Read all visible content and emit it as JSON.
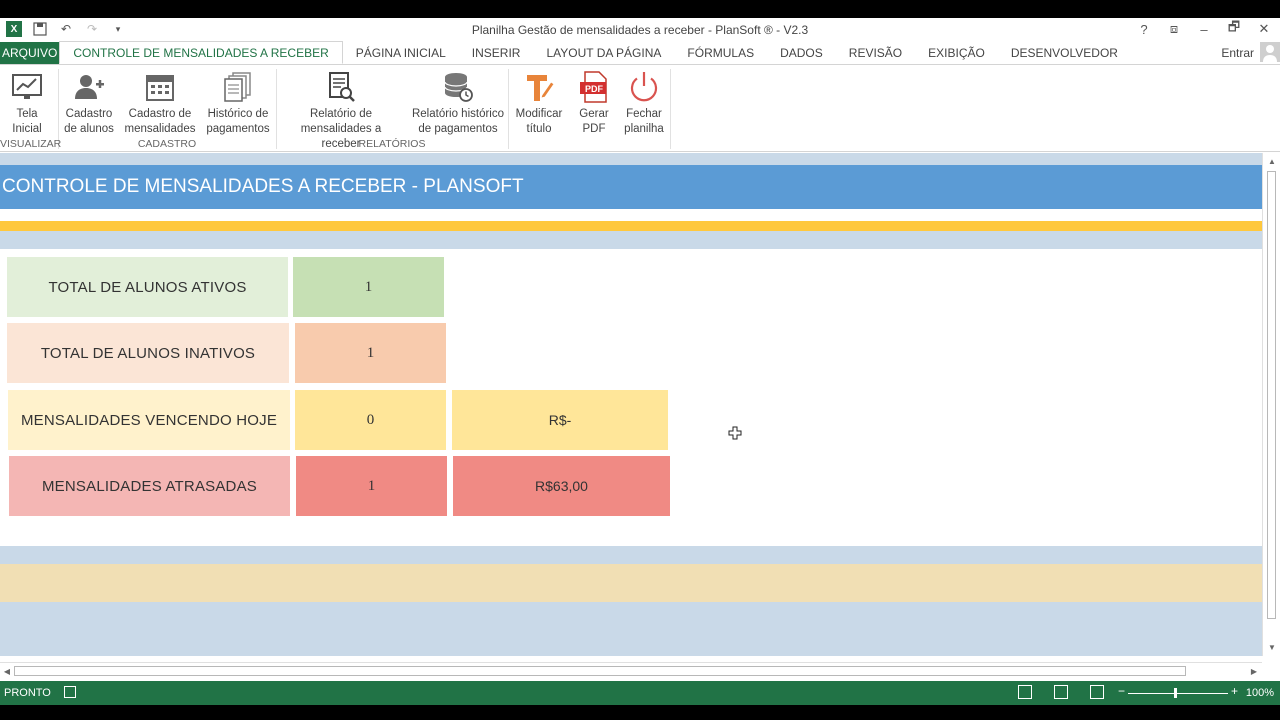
{
  "window": {
    "title": "Planilha Gestão de mensalidades a receber - PlanSoft ® - V2.3",
    "logo": "X",
    "help": "?",
    "controls": [
      "⧈",
      "–",
      "🗗",
      "✕"
    ]
  },
  "tabs": [
    {
      "label": "ARQUIVO",
      "kind": "file"
    },
    {
      "label": "CONTROLE DE MENSALIDADES A RECEBER",
      "kind": "active"
    },
    {
      "label": "PÁGINA INICIAL",
      "kind": ""
    },
    {
      "label": "INSERIR",
      "kind": ""
    },
    {
      "label": "LAYOUT DA PÁGINA",
      "kind": ""
    },
    {
      "label": "FÓRMULAS",
      "kind": ""
    },
    {
      "label": "DADOS",
      "kind": ""
    },
    {
      "label": "REVISÃO",
      "kind": ""
    },
    {
      "label": "EXIBIÇÃO",
      "kind": ""
    },
    {
      "label": "DESENVOLVEDOR",
      "kind": ""
    }
  ],
  "account": {
    "signin": "Entrar"
  },
  "ribbon": {
    "tela_inicial": "Tela\nInicial",
    "cadastro_alunos": "Cadastro\nde alunos",
    "cadastro_mensalidades": "Cadastro de\nmensalidades",
    "historico_pagamentos": "Histórico de\npagamentos",
    "relatorio_mensalidades": "Relatório de\nmensalidades a receber",
    "relatorio_historico": "Relatório histórico\nde pagamentos",
    "modificar_titulo": "Modificar\ntítulo",
    "gerar_pdf": "Gerar\nPDF",
    "fechar_planilha": "Fechar\nplanilha",
    "pdf_badge": "PDF",
    "groups": {
      "visualizar": "VISUALIZAR",
      "cadastro": "CADASTRO",
      "relatorios": "RELATÓRIOS"
    }
  },
  "sheet": {
    "header": "CONTROLE DE MENSALIDADES A RECEBER - PLANSOFT",
    "rows": [
      {
        "label": "TOTAL DE ALUNOS ATIVOS",
        "count": "1",
        "amount": null
      },
      {
        "label": "TOTAL DE ALUNOS INATIVOS",
        "count": "1",
        "amount": null
      },
      {
        "label": "MENSALIDADES VENCENDO HOJE",
        "count": "0",
        "amount": "R$-"
      },
      {
        "label": "MENSALIDADES ATRASADAS",
        "count": "1",
        "amount": "R$63,00"
      }
    ]
  },
  "status": {
    "ready": "PRONTO",
    "zoom": "100%"
  },
  "colors": {
    "excel_green": "#217346",
    "header_blue": "#5b9bd5",
    "gold_stripe": "#ffc83d",
    "light_blue_band": "#c9d9e8",
    "tan_band": "#f1dfb4",
    "active_light": "#e2efd9",
    "active_value": "#c6e0b4",
    "inactive_light": "#fbe5d6",
    "inactive_value": "#f8cbad",
    "today_light": "#fff2cc",
    "today_value": "#ffe699",
    "late_light": "#f4b6b4",
    "late_value": "#f08a84"
  }
}
